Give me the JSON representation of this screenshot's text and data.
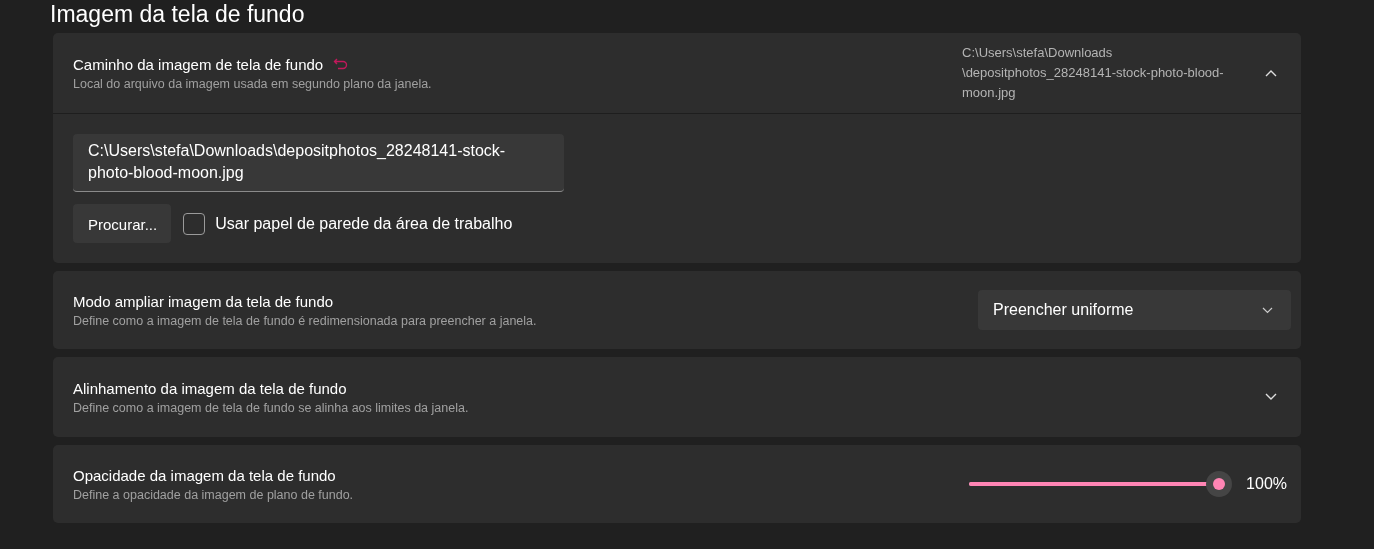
{
  "heading": "Imagem da tela de fundo",
  "settings": [
    {
      "kind": "expander",
      "title": "Caminho da imagem de tela de fundo",
      "description": "Local do arquivo da imagem usada em segundo plano da janela.",
      "modified": true,
      "value": "C:\\Users\\stefa\\Downloads\\depositphotos_28248141-stock-photo-blood-moon.jpg",
      "expanded": true,
      "path_field": {
        "value": "C:\\Users\\stefa\\Downloads\\depositphotos_28248141-stock-photo-blood-moon.jpg"
      },
      "browse_button": "Procurar...",
      "use_desktop": {
        "label": "Usar papel de parede da área de trabalho",
        "checked": false
      }
    },
    {
      "kind": "dropdown",
      "title": "Modo ampliar imagem da tela de fundo",
      "description": "Define como a imagem de tela de fundo é redimensionada para preencher a janela.",
      "value": "Preencher uniforme"
    },
    {
      "kind": "expander",
      "title": "Alinhamento da imagem da tela de fundo",
      "description": "Define como a imagem de tela de fundo se alinha aos limites da janela.",
      "expanded": false
    },
    {
      "kind": "slider",
      "title": "Opacidade da imagem da tela de fundo",
      "description": "Define a opacidade da imagem de plano de fundo.",
      "level": 1,
      "reading": "100%"
    }
  ]
}
